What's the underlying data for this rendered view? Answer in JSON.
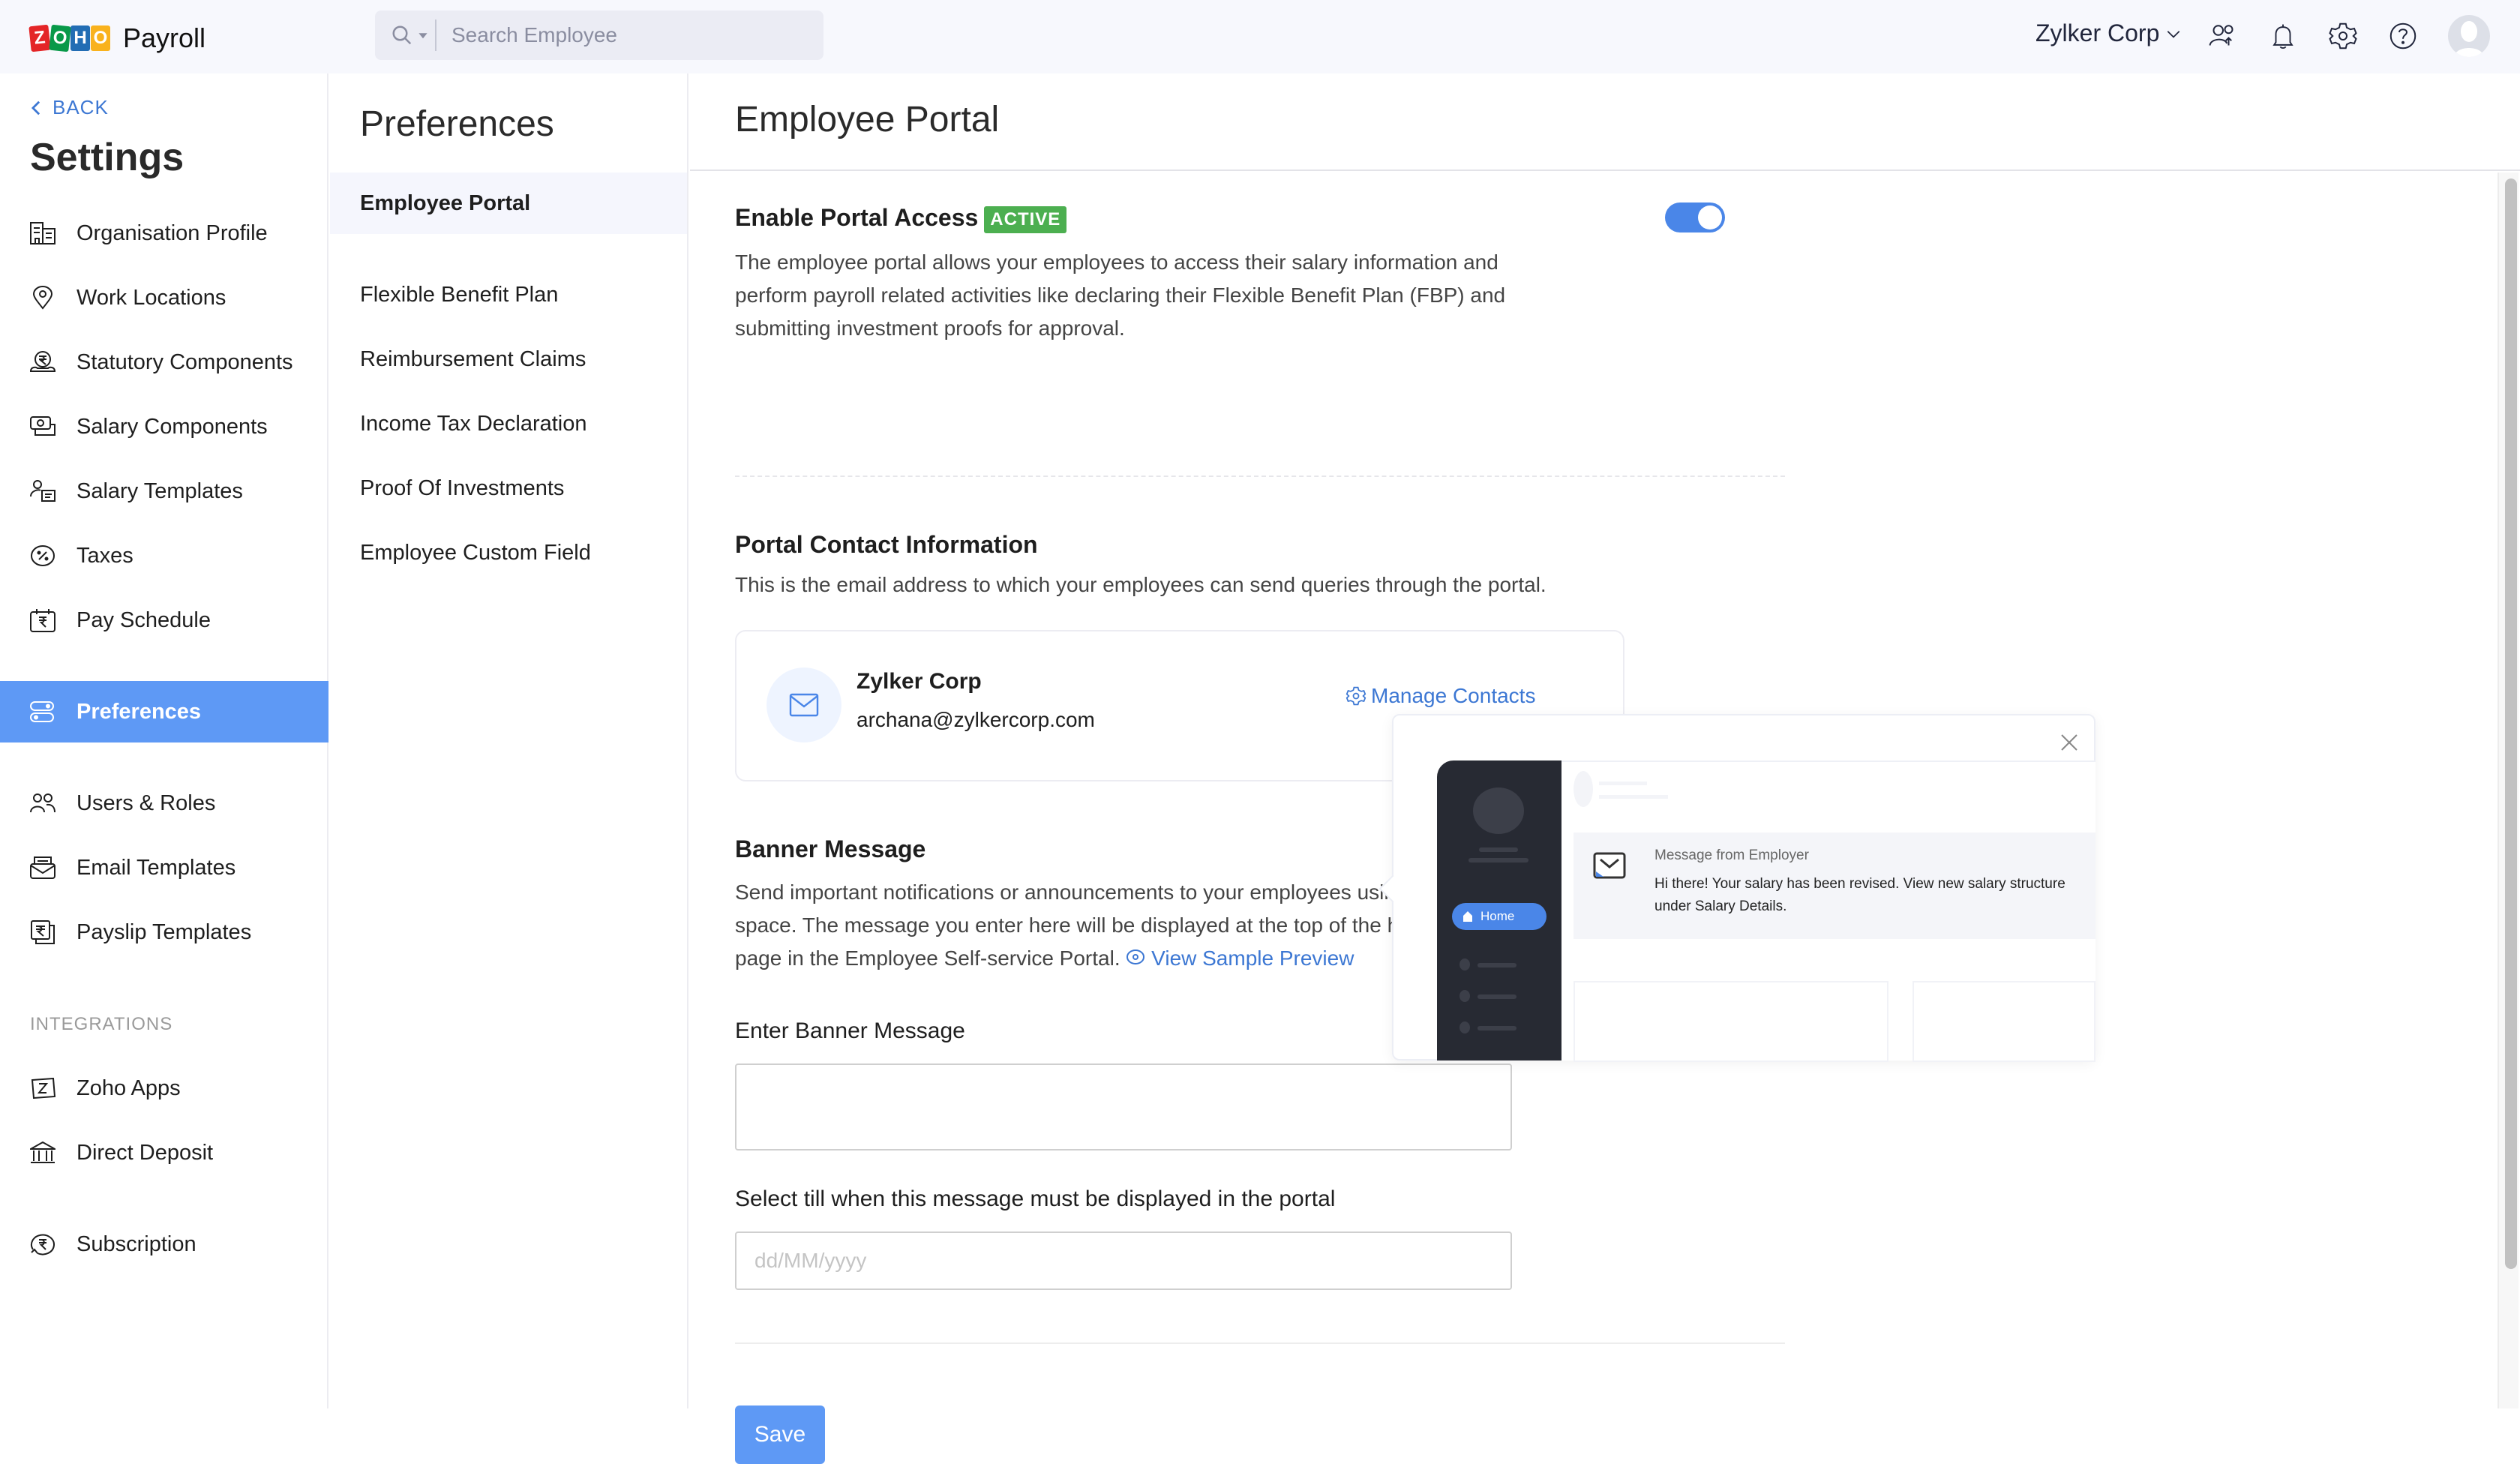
{
  "app": {
    "brand_letters": [
      "Z",
      "O",
      "H",
      "O"
    ],
    "brand_colors": [
      "#e42527",
      "#089949",
      "#226db4",
      "#f9b21d"
    ],
    "product_name": "Payroll"
  },
  "topbar": {
    "search_placeholder": "Search Employee",
    "org_name": "Zylker Corp",
    "icons": [
      "switch-users-icon",
      "bell-icon",
      "gear-icon",
      "help-icon",
      "avatar"
    ]
  },
  "sidebar": {
    "back_label": "BACK",
    "title": "Settings",
    "items": [
      {
        "label": "Organisation Profile",
        "icon": "building-icon"
      },
      {
        "label": "Work Locations",
        "icon": "location-pin-icon"
      },
      {
        "label": "Statutory Components",
        "icon": "rupee-hand-icon"
      },
      {
        "label": "Salary Components",
        "icon": "cash-icon"
      },
      {
        "label": "Salary Templates",
        "icon": "user-template-icon"
      },
      {
        "label": "Taxes",
        "icon": "percent-icon"
      },
      {
        "label": "Pay Schedule",
        "icon": "calendar-rupee-icon"
      },
      {
        "label": "Preferences",
        "icon": "toggles-icon",
        "active": true
      },
      {
        "label": "Users & Roles",
        "icon": "users-icon"
      },
      {
        "label": "Email Templates",
        "icon": "email-template-icon"
      },
      {
        "label": "Payslip Templates",
        "icon": "payslip-icon"
      }
    ],
    "integrations_label": "INTEGRATIONS",
    "integration_items": [
      {
        "label": "Zoho Apps",
        "icon": "zoho-apps-icon"
      },
      {
        "label": "Direct Deposit",
        "icon": "bank-icon"
      }
    ],
    "subscription_label": "Subscription"
  },
  "subnav": {
    "title": "Preferences",
    "items": [
      {
        "label": "Employee Portal",
        "active": true
      },
      {
        "label": "Flexible Benefit Plan"
      },
      {
        "label": "Reimbursement Claims"
      },
      {
        "label": "Income Tax Declaration"
      },
      {
        "label": "Proof Of Investments"
      },
      {
        "label": "Employee Custom Field"
      }
    ]
  },
  "main": {
    "page_title": "Employee Portal",
    "portal_access": {
      "title": "Enable Portal Access",
      "badge": "ACTIVE",
      "enabled": true,
      "description": "The employee portal allows your employees to access their salary information and perform payroll related activities like declaring their Flexible Benefit Plan (FBP) and submitting investment proofs for approval."
    },
    "contact": {
      "title": "Portal Contact Information",
      "description": "This is the email address to which your employees can send queries through the portal.",
      "name": "Zylker Corp",
      "email": "archana@zylkercorp.com",
      "manage_label": "Manage Contacts"
    },
    "banner": {
      "title": "Banner Message",
      "description": "Send important notifications or announcements to your employees using this space. The message you enter here will be displayed at the top of the home page in the Employee Self-service Portal.",
      "preview_link": "View Sample Preview",
      "input_label": "Enter Banner Message",
      "input_value": "",
      "date_label": "Select till when this message must be displayed in the portal",
      "date_placeholder": "dd/MM/yyyy",
      "date_value": ""
    },
    "save_label": "Save"
  },
  "preview_popup": {
    "home_label": "Home",
    "message_title": "Message from Employer",
    "message_body": "Hi there! Your salary has been revised. View new salary structure under Salary Details."
  },
  "colors": {
    "accent": "#5e99f5",
    "link": "#3c77d3",
    "active_badge": "#4caf50",
    "toggle_on": "#4a86e8"
  }
}
